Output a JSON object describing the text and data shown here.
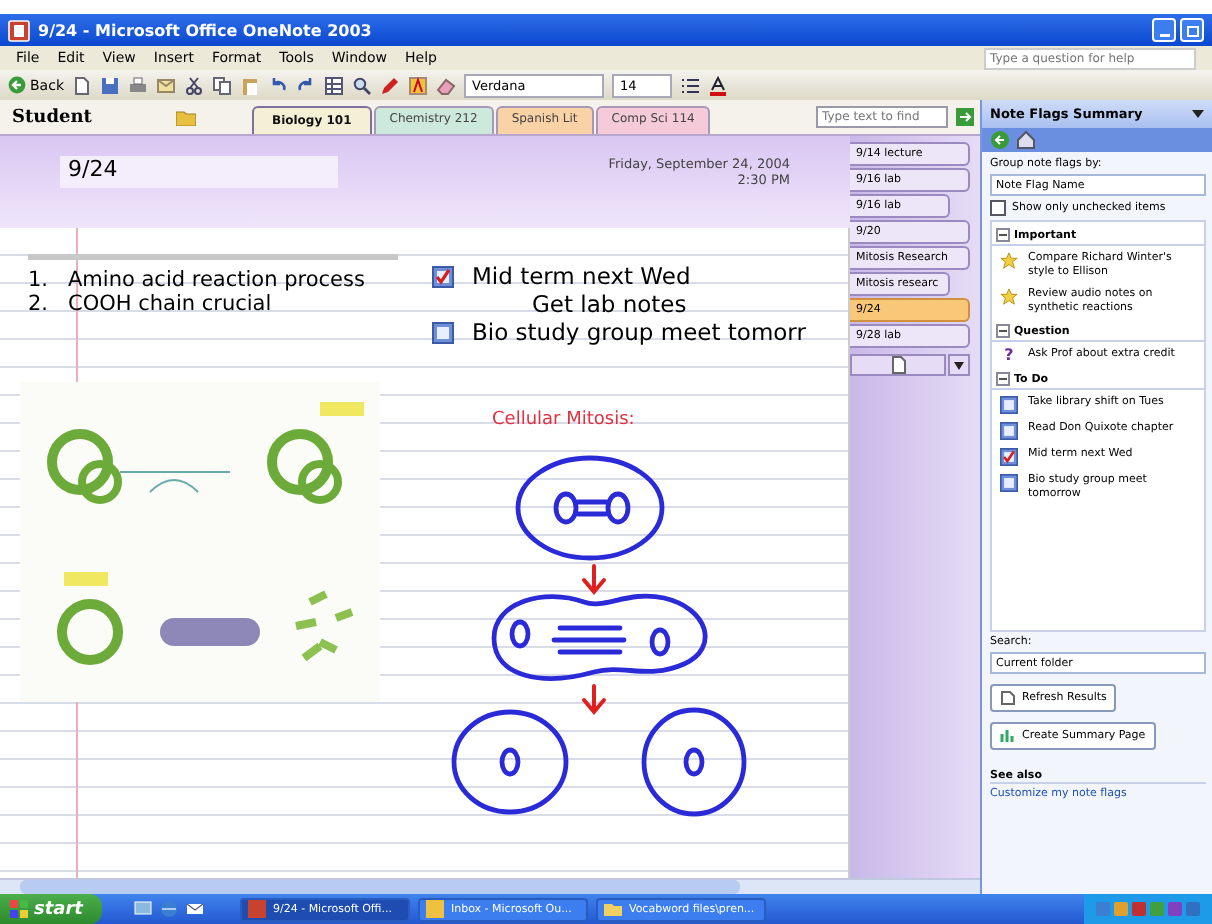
{
  "window": {
    "title": "9/24 - Microsoft Office OneNote 2003"
  },
  "menu": [
    "File",
    "Edit",
    "View",
    "Insert",
    "Format",
    "Tools",
    "Window",
    "Help"
  ],
  "help_box": {
    "placeholder": "Type a question for help"
  },
  "toolbar": {
    "back": "Back",
    "font": "Verdana",
    "size": "14"
  },
  "notebook": {
    "name": "Student"
  },
  "section_tabs": [
    {
      "label": "Biology 101",
      "color": "#f4f0d6",
      "selected": true
    },
    {
      "label": "Chemistry 212",
      "color": "#cde9dc",
      "selected": false
    },
    {
      "label": "Spanish Lit",
      "color": "#f9d2a6",
      "selected": false
    },
    {
      "label": "Comp Sci 114",
      "color": "#f5cbd9",
      "selected": false
    }
  ],
  "find": {
    "placeholder": "Type text to find"
  },
  "page": {
    "title": "9/24",
    "date": "Friday, September 24, 2004",
    "time": "2:30 PM",
    "outline": [
      {
        "number": "1.",
        "text": "Amino acid reaction process"
      },
      {
        "number": "2.",
        "text": "COOH chain crucial"
      }
    ],
    "flags": [
      {
        "text": "Mid term next Wed",
        "kind": "todo",
        "checked": true
      },
      {
        "text": "Get lab notes",
        "kind": "plain"
      },
      {
        "text": "Bio study group meet tomorr",
        "kind": "todo",
        "checked": false
      }
    ],
    "ink_title": "Cellular Mitosis:"
  },
  "page_tabs": [
    {
      "label": "9/14 lecture",
      "kind": "page",
      "selected": false
    },
    {
      "label": "9/16 lab",
      "kind": "page",
      "selected": false
    },
    {
      "label": "9/16 lab",
      "kind": "subpage",
      "selected": false
    },
    {
      "label": "9/20",
      "kind": "page",
      "selected": false
    },
    {
      "label": "Mitosis Research",
      "kind": "page",
      "selected": false
    },
    {
      "label": "Mitosis researc",
      "kind": "subpage",
      "selected": false
    },
    {
      "label": "9/24",
      "kind": "page",
      "selected": true
    },
    {
      "label": "9/28 lab",
      "kind": "page",
      "selected": false
    }
  ],
  "task_pane": {
    "title": "Note Flags Summary",
    "group_label": "Group note flags by:",
    "group_value": "Note Flag Name",
    "unchecked_only": {
      "label": "Show only unchecked items",
      "checked": false
    },
    "groups": [
      {
        "name": "Important",
        "expanded": true,
        "items": [
          {
            "kind": "star",
            "text": "Compare Richard Winter's style to Ellison"
          },
          {
            "kind": "star",
            "text": "Review audio notes on synthetic reactions"
          }
        ]
      },
      {
        "name": "Question",
        "expanded": true,
        "items": [
          {
            "kind": "question",
            "icon": "?",
            "text": "Ask Prof about extra credit"
          }
        ]
      },
      {
        "name": "To Do",
        "expanded": true,
        "items": [
          {
            "kind": "todo",
            "checked": false,
            "text": "Take library shift on Tues"
          },
          {
            "kind": "todo",
            "checked": false,
            "text": "Read Don Quixote chapter"
          },
          {
            "kind": "todo",
            "checked": true,
            "text": "Mid term next Wed"
          },
          {
            "kind": "todo",
            "checked": false,
            "text": "Bio study group meet tomorrow"
          }
        ]
      }
    ],
    "search_label": "Search:",
    "search_value": "Current folder",
    "buttons": [
      {
        "kind": "refresh",
        "label": "Refresh Results"
      },
      {
        "kind": "summary",
        "label": "Create Summary Page"
      }
    ],
    "see_also": "See also",
    "link": "Customize my note flags"
  },
  "taskbar": {
    "start": "start",
    "tasks": [
      {
        "label": "9/24 - Microsoft Offi...",
        "kind": "onenote",
        "selected": true
      },
      {
        "label": "Inbox - Microsoft Ou...",
        "kind": "mail",
        "selected": false
      },
      {
        "label": "Vocabword files\\pren...",
        "kind": "folder",
        "selected": false
      }
    ]
  }
}
